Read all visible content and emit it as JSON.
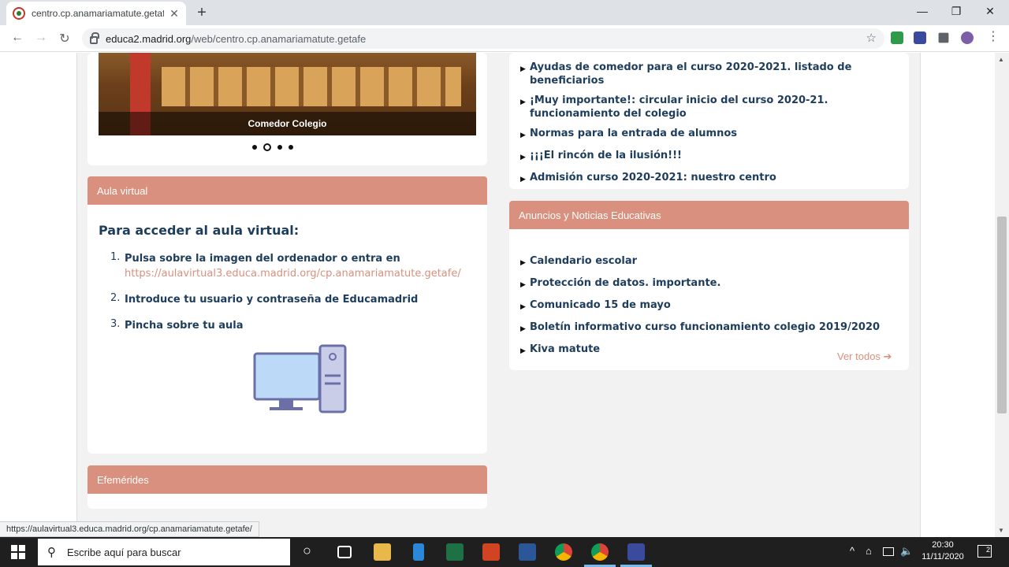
{
  "browser": {
    "tab_title": "centro.cp.anamariamatute.getafe",
    "tab_close": "✕",
    "new_tab": "+",
    "window_controls": {
      "minimize": "—",
      "restore": "❐",
      "close": "✕"
    },
    "url_host": "educa2.madrid.org",
    "url_path": "/web/centro.cp.anamariamatute.getafe",
    "nav": {
      "back": "←",
      "forward": "→",
      "reload": "↻"
    },
    "star": "☆",
    "menu": "⋮"
  },
  "slider": {
    "caption": "Comedor Colegio",
    "slides": 4,
    "active_index": 1
  },
  "aula": {
    "header": "Aula virtual",
    "heading": "Para acceder al aula virtual:",
    "steps": [
      {
        "num": "1.",
        "text": "Pulsa sobre la imagen del ordenador o entra en",
        "link": "https://aulavirtual3.educa.madrid.org/cp.anamariamatute.getafe/"
      },
      {
        "num": "2.",
        "text": "Introduce tu usuario y contraseña de Educamadrid"
      },
      {
        "num": "3.",
        "text": "Pincha sobre tu aula"
      }
    ]
  },
  "efemerides": {
    "header": "Efemérides"
  },
  "top_news": {
    "items": [
      "Ayudas de comedor para el curso 2020-2021. listado de beneficiarios",
      "¡Muy importante!: circular inicio del curso 2020-21. funcionamiento del colegio",
      "Normas para la entrada de alumnos",
      "¡¡¡El rincón de la ilusión!!!",
      "Admisión curso 2020-2021: nuestro centro"
    ]
  },
  "anuncios": {
    "header": "Anuncios y Noticias Educativas",
    "items": [
      "Calendario escolar",
      "Protección de datos. importante.",
      "Comunicado 15 de mayo",
      "Boletín informativo curso funcionamiento colegio 2019/2020",
      "Kiva matute"
    ],
    "ver_todos": "Ver todos ➔"
  },
  "statusbar": {
    "text": "https://aulavirtual3.educa.madrid.org/cp.anamariamatute.getafe/"
  },
  "taskbar": {
    "search_placeholder": "Escribe aquí para buscar",
    "search_icon": "⚲",
    "cortana": "○",
    "tray": {
      "chevron": "^",
      "network": "⌂",
      "volume": "🔈"
    },
    "time": "20:30",
    "date": "11/11/2020",
    "notif_count": "2"
  },
  "colors": {
    "accent": "#d9907e",
    "text": "#1e3d5c"
  }
}
